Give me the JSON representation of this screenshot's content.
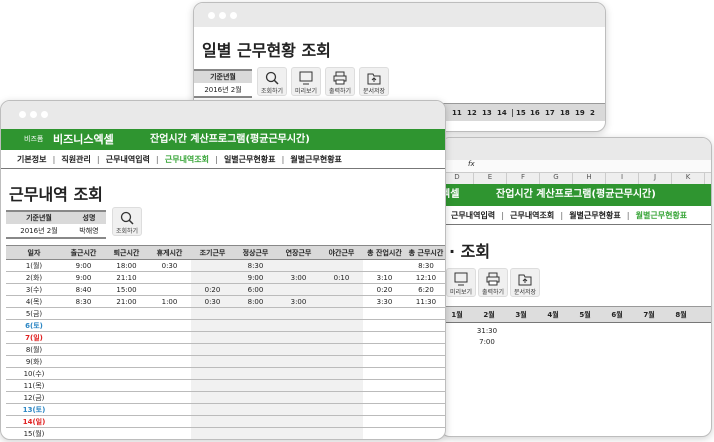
{
  "back_window": {
    "title": "일별 근무현황 조회",
    "param_header": "기준년월",
    "param_value": "2016년 2월",
    "buttons": [
      "조회하기",
      "미리보기",
      "출력하기",
      "문서저장"
    ],
    "day_columns": [
      "11",
      "12",
      "13",
      "14",
      "15",
      "16",
      "17",
      "18",
      "19",
      "2"
    ]
  },
  "right_window": {
    "formula_icon": "fx",
    "column_letters": [
      "D",
      "E",
      "F",
      "G",
      "H",
      "I",
      "J",
      "K"
    ],
    "brand_partial": "엑셀",
    "program_title": "잔업시간 계산프로그램(평균근무시간)",
    "nav": [
      "근무내역입력",
      "근무내역조회",
      "월별근무현황표",
      "월별근무현황표"
    ],
    "active_nav": 3,
    "title_partial": "· 조회",
    "buttons": [
      "미리보기",
      "출력하기",
      "문서저장"
    ],
    "months": [
      "1월",
      "2월",
      "3월",
      "4월",
      "5월",
      "6월",
      "7월",
      "8월"
    ],
    "values": [
      "31:30",
      "7:00"
    ]
  },
  "front_window": {
    "brand_small": "비즈폼",
    "brand": "비즈니스엑셀",
    "program_title": "잔업시간 계산프로그램(평균근무시간)",
    "nav": [
      "기본정보",
      "직원관리",
      "근무내역입력",
      "근무내역조회",
      "일별근무현황표",
      "월별근무현황표"
    ],
    "active_nav": 3,
    "title": "근무내역 조회",
    "params": {
      "headers": [
        "기준년월",
        "성명"
      ],
      "values": [
        "2016년 2월",
        "박해영"
      ]
    },
    "search_button": "조회하기",
    "table": {
      "headers": [
        "일자",
        "출근시간",
        "퇴근시간",
        "휴게시간",
        "조기근무",
        "정상근무",
        "연장근무",
        "야간근무",
        "총 잔업시간",
        "총 근무시간"
      ],
      "rows": [
        [
          "1(월)",
          "9:00",
          "18:00",
          "0:30",
          "",
          "8:30",
          "",
          "",
          "",
          "8:30"
        ],
        [
          "2(화)",
          "9:00",
          "21:10",
          "",
          "",
          "9:00",
          "3:00",
          "0:10",
          "3:10",
          "12:10"
        ],
        [
          "3(수)",
          "8:40",
          "15:00",
          "",
          "0:20",
          "6:00",
          "",
          "",
          "0:20",
          "6:20"
        ],
        [
          "4(목)",
          "8:30",
          "21:00",
          "1:00",
          "0:30",
          "8:00",
          "3:00",
          "",
          "3:30",
          "11:30"
        ],
        [
          "5(금)",
          "",
          "",
          "",
          "",
          "",
          "",
          "",
          "",
          ""
        ],
        [
          "6(토)",
          "",
          "",
          "",
          "",
          "",
          "",
          "",
          "",
          ""
        ],
        [
          "7(일)",
          "",
          "",
          "",
          "",
          "",
          "",
          "",
          "",
          ""
        ],
        [
          "8(월)",
          "",
          "",
          "",
          "",
          "",
          "",
          "",
          "",
          ""
        ],
        [
          "9(화)",
          "",
          "",
          "",
          "",
          "",
          "",
          "",
          "",
          ""
        ],
        [
          "10(수)",
          "",
          "",
          "",
          "",
          "",
          "",
          "",
          "",
          ""
        ],
        [
          "11(목)",
          "",
          "",
          "",
          "",
          "",
          "",
          "",
          "",
          ""
        ],
        [
          "12(금)",
          "",
          "",
          "",
          "",
          "",
          "",
          "",
          "",
          ""
        ],
        [
          "13(토)",
          "",
          "",
          "",
          "",
          "",
          "",
          "",
          "",
          ""
        ],
        [
          "14(일)",
          "",
          "",
          "",
          "",
          "",
          "",
          "",
          "",
          ""
        ],
        [
          "15(월)",
          "",
          "",
          "",
          "",
          "",
          "",
          "",
          "",
          ""
        ]
      ]
    }
  },
  "colors": {
    "brand_green": "#2f9530",
    "saturday": "#2b86c4",
    "sunday": "#e02020",
    "active_nav": "#3aa63a"
  }
}
